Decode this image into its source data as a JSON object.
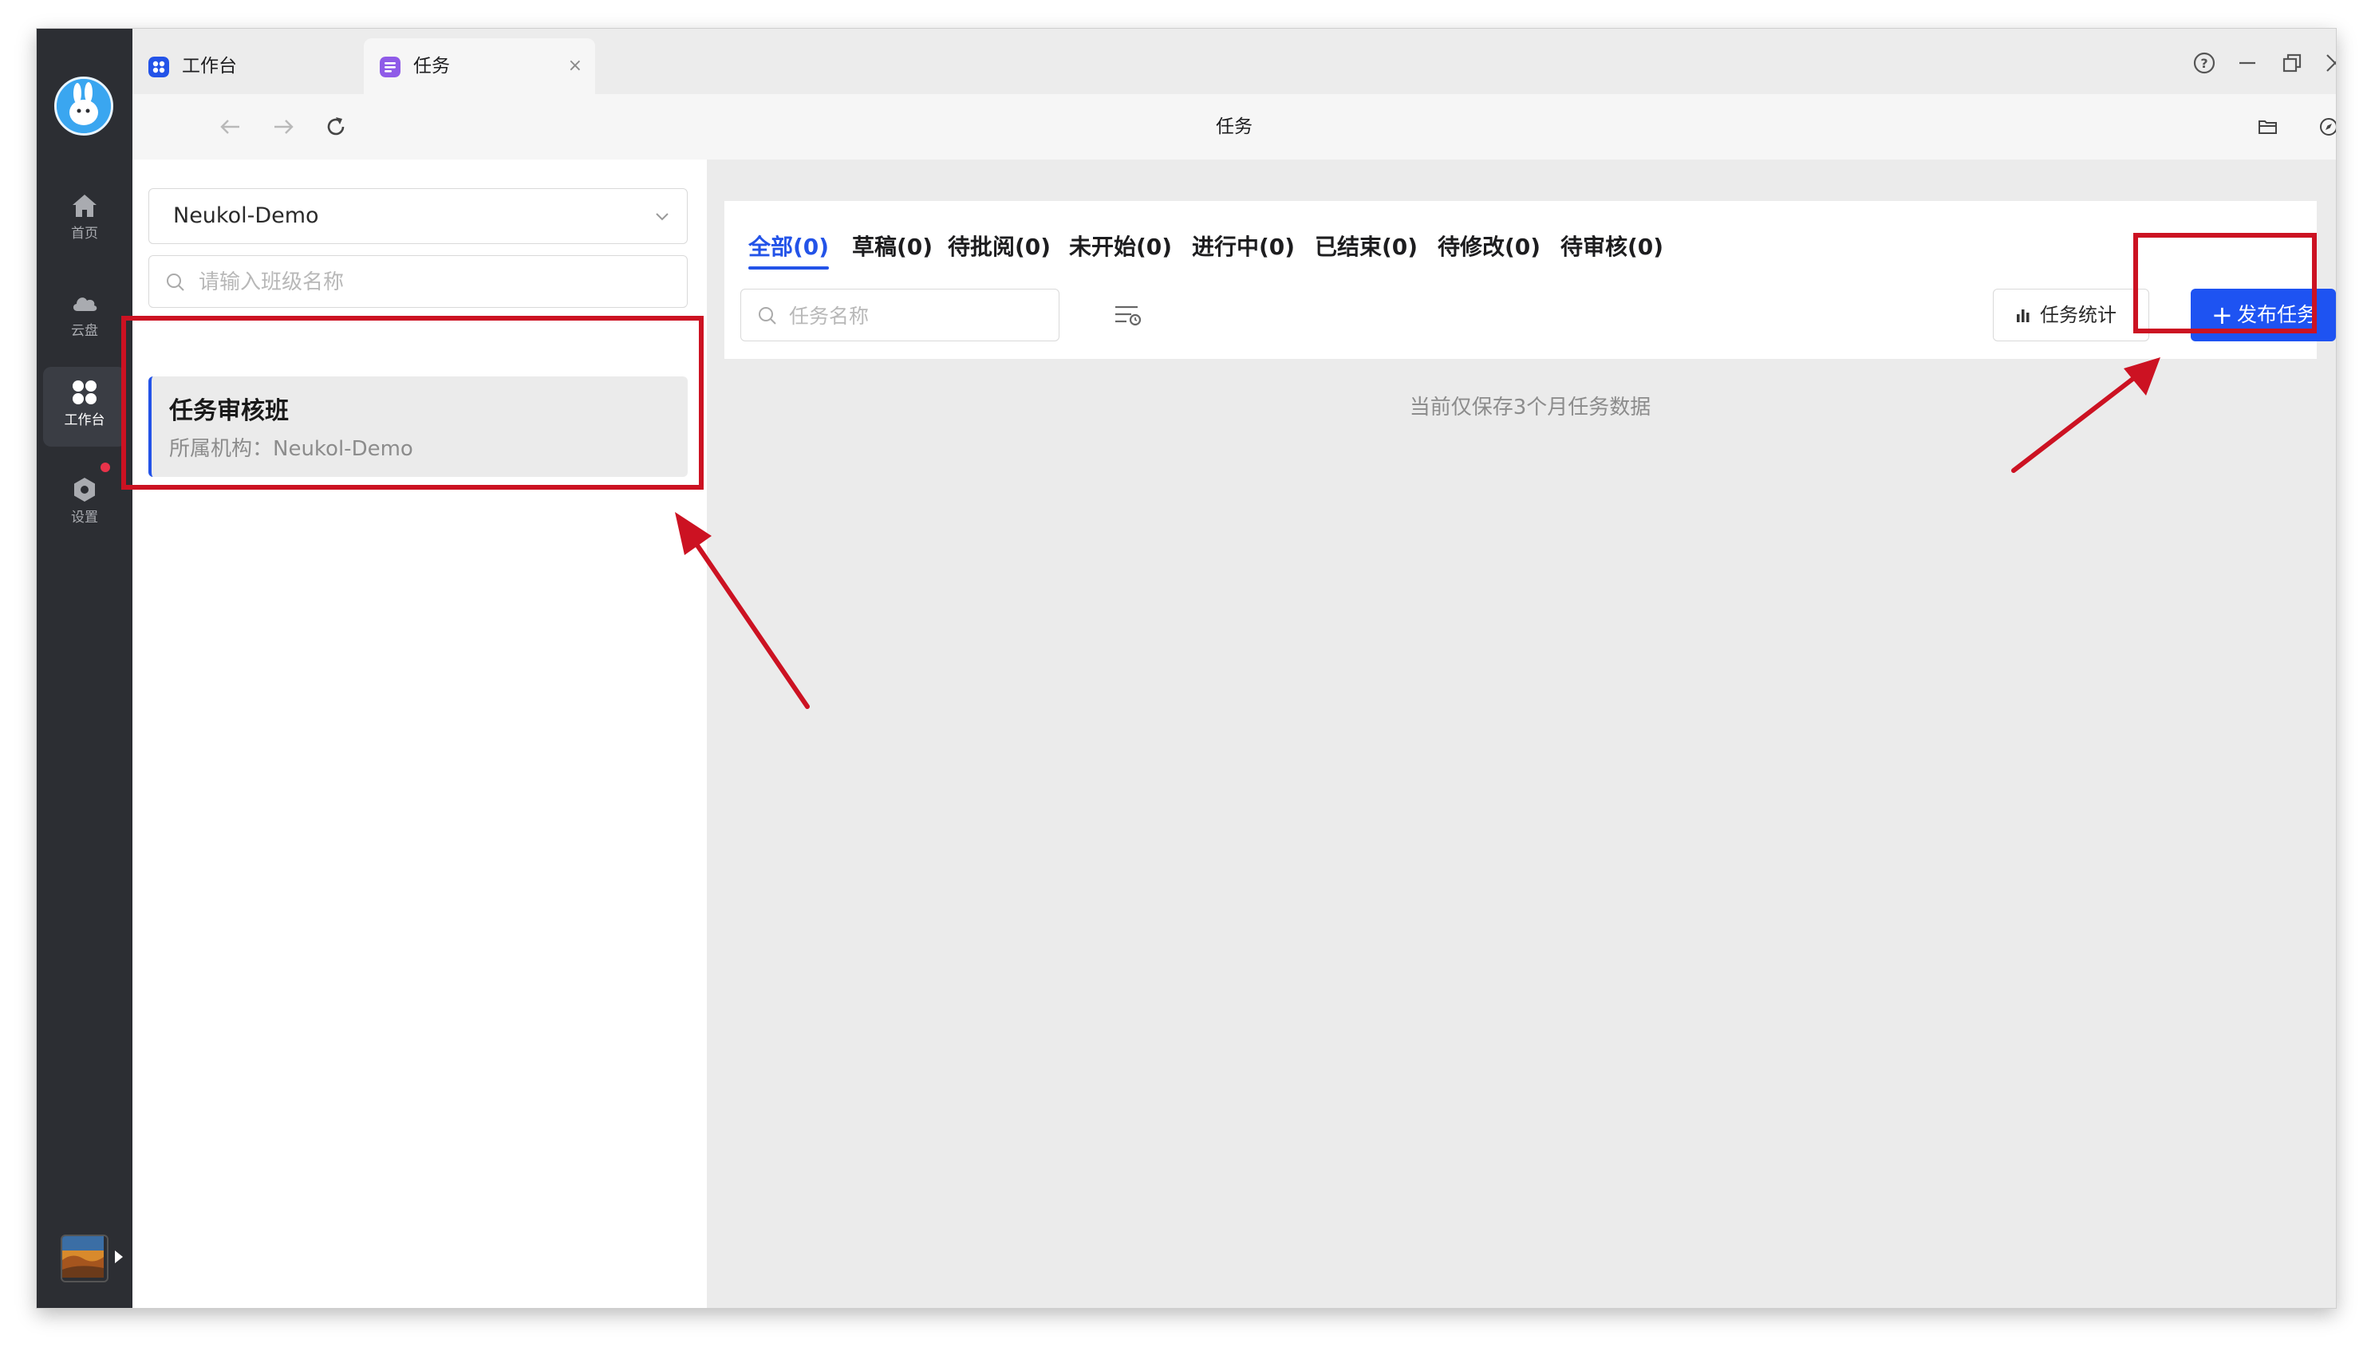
{
  "rail": {
    "items": [
      {
        "label": "首页",
        "icon": "home-icon"
      },
      {
        "label": "云盘",
        "icon": "cloud-icon"
      },
      {
        "label": "工作台",
        "icon": "grid-icon"
      },
      {
        "label": "设置",
        "icon": "settings-hex-icon"
      }
    ]
  },
  "tabs": [
    {
      "label": "工作台",
      "icon": "workbench-icon"
    },
    {
      "label": "任务",
      "icon": "task-icon",
      "close": "×"
    }
  ],
  "toolbar": {
    "page_title": "任务"
  },
  "left_panel": {
    "org_select_value": "Neukol-Demo",
    "class_search_placeholder": "请输入班级名称",
    "class_card": {
      "name": "任务审核班",
      "org": "所属机构：Neukol-Demo"
    }
  },
  "main": {
    "status_tabs": [
      {
        "label": "全部(0)"
      },
      {
        "label": "草稿(0)"
      },
      {
        "label": "待批阅(0)"
      },
      {
        "label": "未开始(0)"
      },
      {
        "label": "进行中(0)"
      },
      {
        "label": "已结束(0)"
      },
      {
        "label": "待修改(0)"
      },
      {
        "label": "待审核(0)"
      }
    ],
    "task_search_placeholder": "任务名称",
    "stats_button": "任务统计",
    "publish_button": "发布任务",
    "notice": "当前仅保存3个月任务数据"
  },
  "colors": {
    "accent": "#2353e8",
    "publish_button": "#1e53f2",
    "annotation": "#cc1222",
    "rail": "#2c2e33"
  }
}
